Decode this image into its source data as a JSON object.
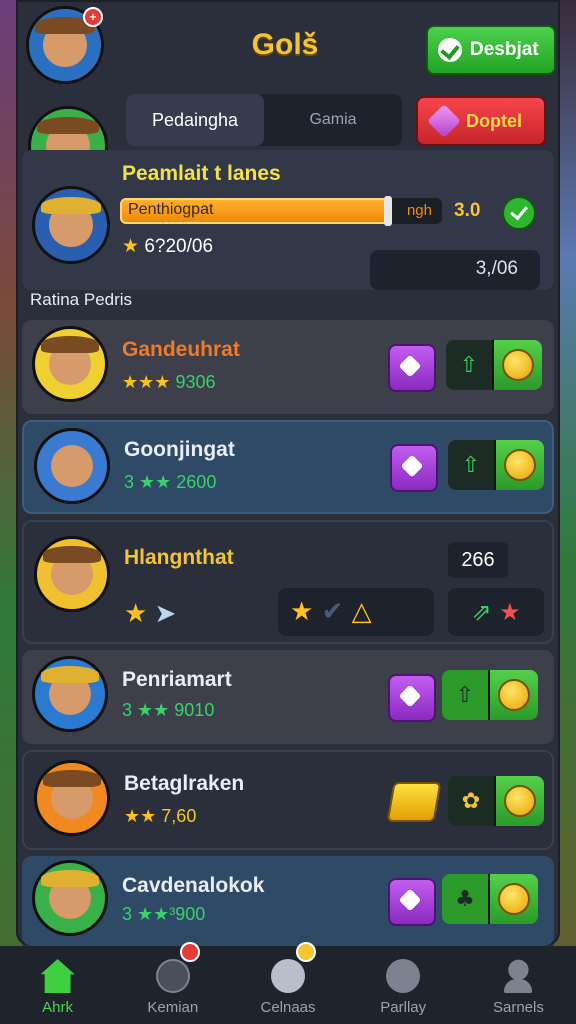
{
  "header": {
    "title": "Golš",
    "primary_button_label": "Desbjat",
    "secondary_button_label": "Doptel",
    "avatar_badge": "+"
  },
  "tabs": [
    {
      "label": "Pedaingha",
      "active": true
    },
    {
      "label": "Gamia",
      "active": false
    }
  ],
  "summary": {
    "title": "Peamlait t lanes",
    "progress_label": "Penthiogpat",
    "progress_tail": "ngh",
    "progress_fraction": 0.84,
    "score": "3.0",
    "stars_text": "6?20/06",
    "stat_value": "3,/06"
  },
  "section_label": "Ratina Pedris",
  "rows": [
    {
      "name": "Gandeuhrat",
      "sub": "9306",
      "stars": "★★★",
      "name_color": "#f07a2a"
    },
    {
      "name": "Goonjingat",
      "sub": "3 ★★ 2600",
      "stars": "",
      "name_color": "#e9eef5"
    },
    {
      "name": "Hlangnthat",
      "sub": "",
      "stars": "",
      "name_color": "#f5c431",
      "count": "266"
    },
    {
      "name": "Penriamart",
      "sub": "3 ★★ 9010",
      "stars": "",
      "name_color": "#e9eef5"
    },
    {
      "name": "Betaglraken",
      "sub": "7,60",
      "stars": "★★",
      "name_color": "#e9eef5"
    },
    {
      "name": "Cavdenalokok",
      "sub": "3 ★★³900",
      "stars": "",
      "name_color": "#e9eef5"
    }
  ],
  "nav": [
    {
      "label": "Ahrk",
      "active": true
    },
    {
      "label": "Kemian",
      "active": false
    },
    {
      "label": "Celnaas",
      "active": false
    },
    {
      "label": "Parllay",
      "active": false
    },
    {
      "label": "Sarnels",
      "active": false
    }
  ],
  "colors": {
    "accent_gold": "#f5c431",
    "accent_green": "#44d84a",
    "accent_red": "#e53a3a",
    "panel": "#2a2f3b"
  }
}
